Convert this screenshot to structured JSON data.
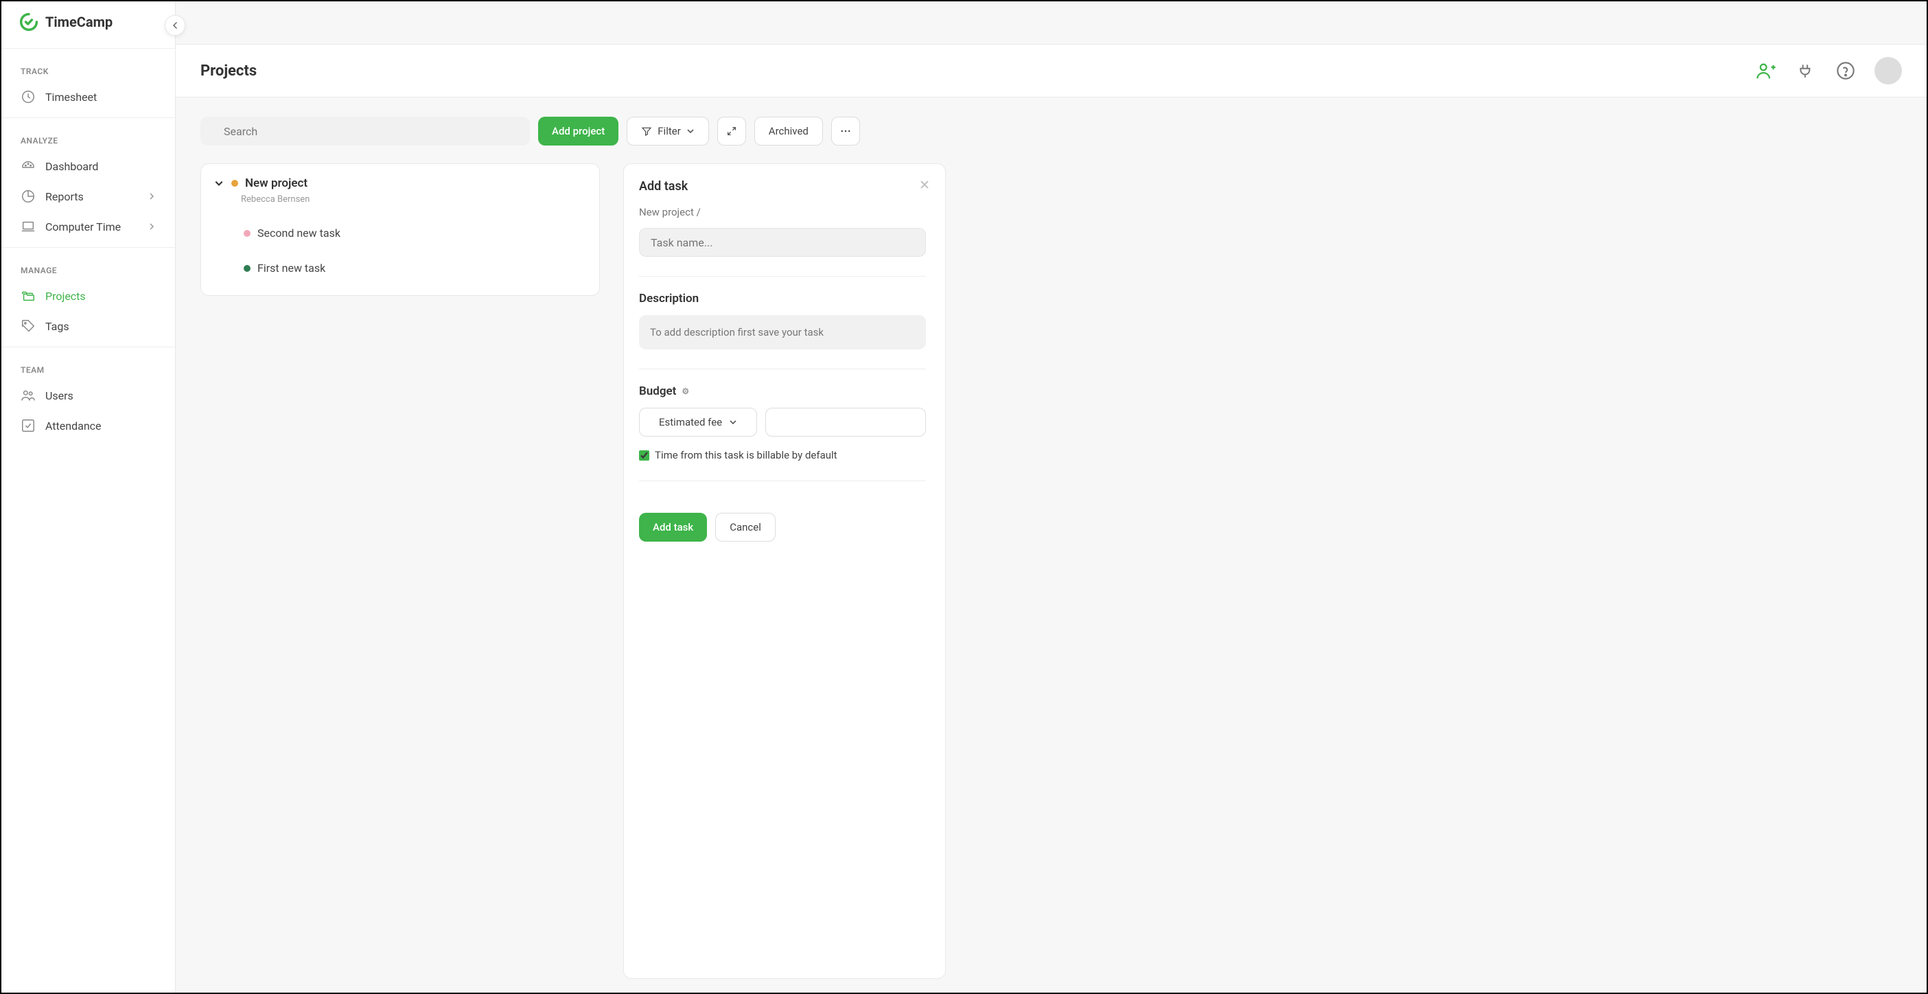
{
  "app": {
    "name": "TimeCamp"
  },
  "sidebar": {
    "sections": {
      "track": {
        "label": "TRACK",
        "items": [
          {
            "label": "Timesheet"
          }
        ]
      },
      "analyze": {
        "label": "ANALYZE",
        "items": [
          {
            "label": "Dashboard"
          },
          {
            "label": "Reports"
          },
          {
            "label": "Computer Time"
          }
        ]
      },
      "manage": {
        "label": "MANAGE",
        "items": [
          {
            "label": "Projects"
          },
          {
            "label": "Tags"
          }
        ]
      },
      "team": {
        "label": "TEAM",
        "items": [
          {
            "label": "Users"
          },
          {
            "label": "Attendance"
          }
        ]
      }
    }
  },
  "page": {
    "title": "Projects"
  },
  "toolbar": {
    "search_placeholder": "Search",
    "add_project": "Add project",
    "filter": "Filter",
    "archived": "Archived"
  },
  "project": {
    "name": "New project",
    "owner": "Rebecca Bernsen",
    "tasks": [
      {
        "name": "Second new task"
      },
      {
        "name": "First new task"
      }
    ]
  },
  "detail": {
    "title": "Add task",
    "breadcrumb": "New project /",
    "name_placeholder": "Task name...",
    "description_label": "Description",
    "description_placeholder": "To add description first save your task",
    "budget_label": "Budget",
    "budget_type": "Estimated fee",
    "billable_label": "Time from this task is billable by default",
    "add_btn": "Add task",
    "cancel_btn": "Cancel"
  }
}
